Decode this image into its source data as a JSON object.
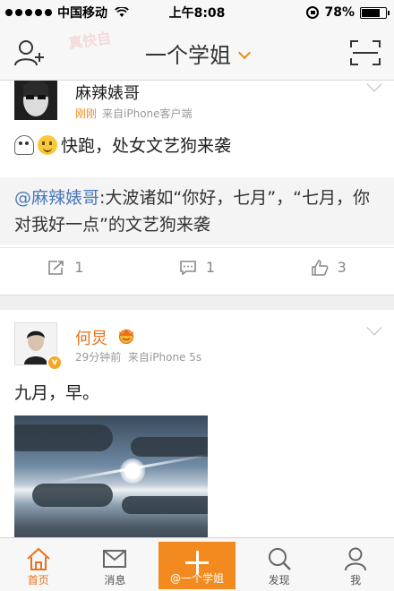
{
  "status_bar": {
    "carrier": "中国移动",
    "time": "上午8:08",
    "battery": "78%",
    "battery_level": 0.78
  },
  "nav": {
    "title": "一个学姐",
    "watermark": "真快自"
  },
  "posts": [
    {
      "author": "麻辣婊哥",
      "time_label": "刚刚",
      "source": "来自iPhone客户端",
      "text": "快跑，处女文艺狗来袭",
      "repost_at": "@麻辣婊哥",
      "repost_text": ":大波诸如“你好，七月”，“七月，你对我好一点”的文艺狗来袭",
      "actions": {
        "repost": "1",
        "comment": "1",
        "like": "3"
      }
    },
    {
      "author": "何炅",
      "time_label": "29分钟前",
      "source": "来自iPhone 5s",
      "verified_badge": "v",
      "text": "九月，早。"
    }
  ],
  "tabs": [
    {
      "label": "首页",
      "icon": "home-icon",
      "active": true
    },
    {
      "label": "消息",
      "icon": "message-icon"
    },
    {
      "label": "@一个学姐",
      "icon": "plus-icon"
    },
    {
      "label": "发现",
      "icon": "search-icon"
    },
    {
      "label": "我",
      "icon": "profile-icon"
    }
  ],
  "colors": {
    "accent": "#f08a1c",
    "link": "#4a78b8",
    "compose": "#f28a20"
  }
}
